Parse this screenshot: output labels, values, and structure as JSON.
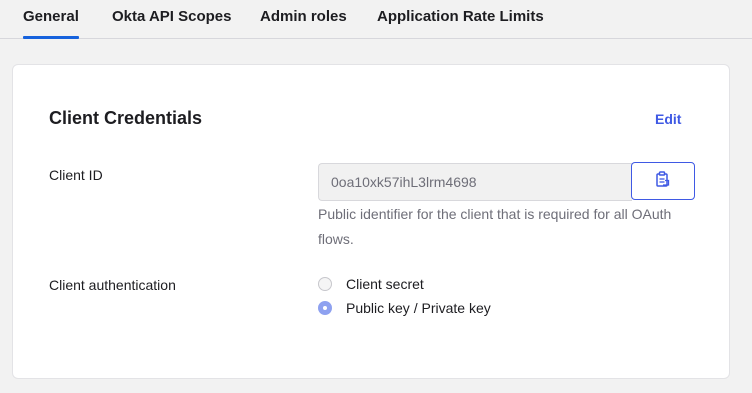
{
  "tabs": [
    {
      "label": "General",
      "active": true
    },
    {
      "label": "Okta API Scopes",
      "active": false
    },
    {
      "label": "Admin roles",
      "active": false
    },
    {
      "label": "Application Rate Limits",
      "active": false
    }
  ],
  "card": {
    "title": "Client Credentials",
    "edit_label": "Edit",
    "client_id": {
      "label": "Client ID",
      "value": "0oa10xk57ihL3lrm4698",
      "hint": "Public identifier for the client that is required for all OAuth flows.",
      "copy_icon": "clipboard-icon"
    },
    "client_auth": {
      "label": "Client authentication",
      "options": [
        {
          "label": "Client secret",
          "selected": false
        },
        {
          "label": "Public key / Private key",
          "selected": true
        }
      ]
    }
  },
  "colors": {
    "accent": "#3f59e4",
    "tab_indicator": "#1662dd",
    "radio_selected": "#8ea1f0",
    "background": "#f2f2f2"
  }
}
